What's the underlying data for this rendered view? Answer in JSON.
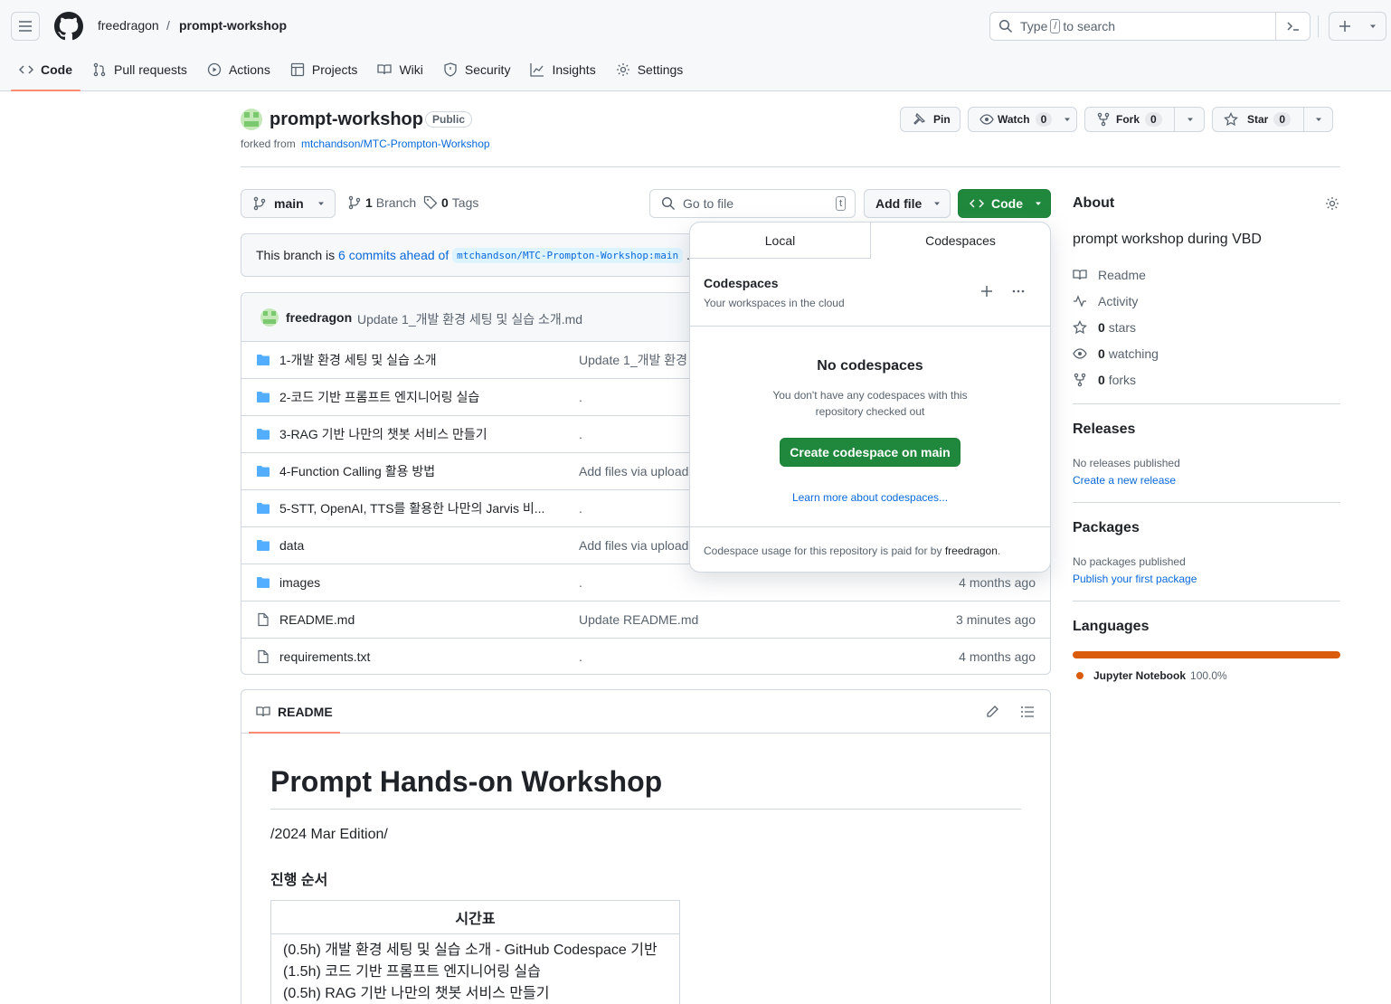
{
  "header": {
    "owner": "freedragon",
    "separator": "/",
    "repo": "prompt-workshop",
    "search_prefix": "Type",
    "search_key": "/",
    "search_suffix": "to search"
  },
  "nav_tabs": [
    {
      "label": "Code",
      "icon": "code-icon"
    },
    {
      "label": "Pull requests",
      "icon": "pull-request-icon"
    },
    {
      "label": "Actions",
      "icon": "play-icon"
    },
    {
      "label": "Projects",
      "icon": "table-icon"
    },
    {
      "label": "Wiki",
      "icon": "book-icon"
    },
    {
      "label": "Security",
      "icon": "shield-icon"
    },
    {
      "label": "Insights",
      "icon": "graph-icon"
    },
    {
      "label": "Settings",
      "icon": "gear-icon"
    }
  ],
  "repo": {
    "name": "prompt-workshop",
    "visibility": "Public",
    "forked_from_label": "forked from",
    "forked_from": "mtchandson/MTC-Prompton-Workshop",
    "pin": "Pin",
    "watch": "Watch",
    "watch_count": "0",
    "fork": "Fork",
    "fork_count": "0",
    "star": "Star",
    "star_count": "0"
  },
  "toolbar": {
    "branch": "main",
    "branches": "1",
    "branches_label": "Branch",
    "tags": "0",
    "tags_label": "Tags",
    "goto_placeholder": "Go to file",
    "goto_key": "t",
    "add_file": "Add file",
    "code": "Code"
  },
  "branch_notice": {
    "prefix": "This branch is",
    "link": "6 commits ahead of",
    "ref": "mtchandson/MTC-Prompton-Workshop:main",
    "suffix": "."
  },
  "latest_commit": {
    "author": "freedragon",
    "message": "Update 1_개발 환경 세팅 및 실습 소개.md"
  },
  "files": [
    {
      "name": "1-개발 환경 세팅 및 실습 소개",
      "type": "dir",
      "msg": "Update 1_개발 환경",
      "age": ""
    },
    {
      "name": "2-코드 기반 프롬프트 엔지니어링 실습",
      "type": "dir",
      "msg": ".",
      "age": ""
    },
    {
      "name": "3-RAG 기반 나만의 챗봇 서비스 만들기",
      "type": "dir",
      "msg": ".",
      "age": ""
    },
    {
      "name": "4-Function Calling 활용 방법",
      "type": "dir",
      "msg": "Add files via upload",
      "age": ""
    },
    {
      "name": "5-STT, OpenAI, TTS를 활용한 나만의 Jarvis 비...",
      "type": "dir",
      "msg": ".",
      "age": ""
    },
    {
      "name": "data",
      "type": "dir",
      "msg": "Add files via upload",
      "age": ""
    },
    {
      "name": "images",
      "type": "dir",
      "msg": ".",
      "age": "4 months ago"
    },
    {
      "name": "README.md",
      "type": "file",
      "msg": "Update README.md",
      "age": "3 minutes ago"
    },
    {
      "name": "requirements.txt",
      "type": "file",
      "msg": ".",
      "age": "4 months ago"
    }
  ],
  "codespaces": {
    "tab_local": "Local",
    "tab_codespaces": "Codespaces",
    "title": "Codespaces",
    "subtitle": "Your workspaces in the cloud",
    "empty_title": "No codespaces",
    "empty_line1": "You don't have any codespaces with this",
    "empty_line2": "repository checked out",
    "create_button": "Create codespace on main",
    "learn_more": "Learn more about codespaces...",
    "footer_prefix": "Codespace usage for this repository is paid for by",
    "footer_user": "freedragon",
    "footer_suffix": "."
  },
  "about": {
    "title": "About",
    "description": "prompt workshop during VBD",
    "readme": "Readme",
    "activity": "Activity",
    "stars": "0",
    "stars_label": "stars",
    "watching": "0",
    "watching_label": "watching",
    "forks": "0",
    "forks_label": "forks"
  },
  "releases": {
    "title": "Releases",
    "empty": "No releases published",
    "link": "Create a new release"
  },
  "packages": {
    "title": "Packages",
    "empty": "No packages published",
    "link": "Publish your first package"
  },
  "languages": {
    "title": "Languages",
    "items": [
      {
        "name": "Jupyter Notebook",
        "percent": "100.0%",
        "value": 100,
        "color": "#DA5B0B"
      }
    ]
  },
  "readme": {
    "tab": "README",
    "h1": "Prompt Hands-on Workshop",
    "edition": "/2024 Mar Edition/",
    "h3": "진행 순서",
    "table_header": "시간표",
    "rows": [
      "(0.5h) 개발 환경 세팅 및 실습 소개 - GitHub Codespace 기반",
      "(1.5h) 코드 기반 프롬프트 엔지니어링 실습",
      "(0.5h) RAG 기반 나만의 챗봇 서비스 만들기"
    ]
  },
  "colors": {
    "accent": "#0969da",
    "primary_button": "#1f883d",
    "tab_underline": "#fd8c73",
    "folder": "#54aeff"
  }
}
